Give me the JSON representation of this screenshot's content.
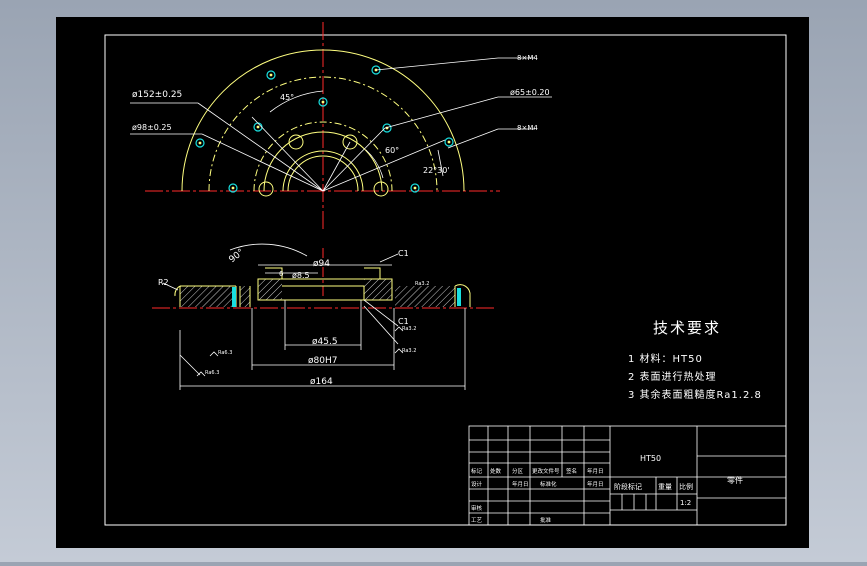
{
  "colors": {
    "background": "#000000",
    "frame": "#ffffff",
    "centerline": "#ff2a2a",
    "outline": "#ffff80",
    "dimension": "#ffffff",
    "hatch": "#ffffff",
    "hole_marker": "#19e0e0",
    "hole_center": "#ff3a3a"
  },
  "top_view": {
    "labels": {
      "od_bolt": "ø152±0.25",
      "id_bolt": "ø98±0.25",
      "holes_top": "8×M4",
      "inner_circle": "ø65±0.20",
      "holes_right": "8×M4",
      "angle_45": "45°",
      "angle_60": "60°",
      "angle_22_30": "22°30'"
    }
  },
  "section_view": {
    "labels": {
      "angle_90": "90°",
      "d94": "ø94",
      "d8_5": "ø8.5",
      "dim_6": "6",
      "chamfer_top": "C1",
      "chamfer_bottom": "C1",
      "radius": "R2",
      "d45_5": "ø45.5",
      "d80h7": "ø80H7",
      "d164": "ø164",
      "roughness_a": "Ra6.3",
      "roughness_b": "Ra3.2"
    }
  },
  "tech_requirements": {
    "title": "技术要求",
    "items": [
      "1  材料：HT50",
      "2  表面进行热处理",
      "3  其余表面粗糙度Ra1.2.8"
    ]
  },
  "title_block": {
    "material": "HT50",
    "part_name": "零件",
    "scale_value": "1:2",
    "stage_label": "阶段标记",
    "weight_label": "重量",
    "scale_label": "比例",
    "row_labels": [
      "标记",
      "设计",
      "审核",
      "工艺"
    ],
    "header_cells": [
      "处数",
      "分区",
      "更改文件号",
      "签名",
      "年月日"
    ],
    "design_date": "年月日",
    "standardize": "标准化",
    "approve": "批准"
  }
}
